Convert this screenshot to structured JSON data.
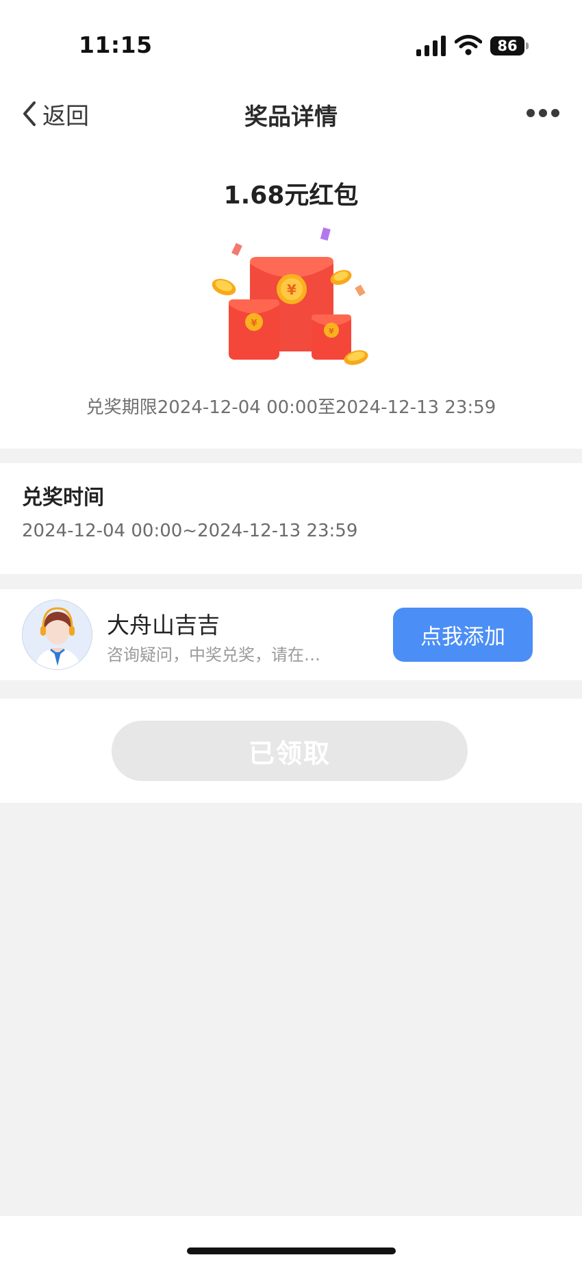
{
  "status_bar": {
    "time": "11:15",
    "battery": "86"
  },
  "nav": {
    "back_label": "返回",
    "title": "奖品详情",
    "more_icon": "ellipsis-icon"
  },
  "prize": {
    "title": "1.68元红包",
    "image_icon": "red-envelope-icon",
    "validity": "兑奖期限2024-12-04 00:00至2024-12-13 23:59"
  },
  "redeem_time": {
    "heading": "兑奖时间",
    "value": "2024-12-04 00:00~2024-12-13 23:59"
  },
  "contact": {
    "name": "大舟山吉吉",
    "description": "咨询疑问，中奖兑奖，请在…",
    "button_label": "点我添加"
  },
  "action": {
    "button_label": "已领取"
  },
  "colors": {
    "accent": "#4b8ef6",
    "envelope_red": "#f24a3c",
    "coin_gold": "#f9b21f",
    "page_bg": "#f2f2f2"
  }
}
